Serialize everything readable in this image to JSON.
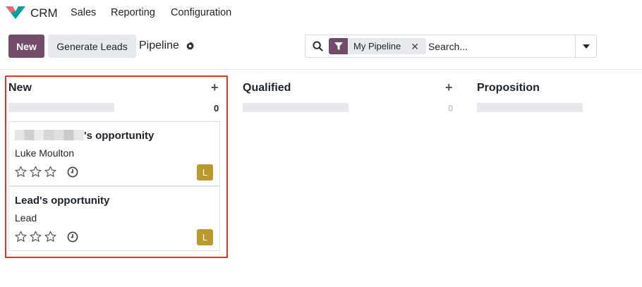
{
  "topnav": {
    "app_name": "CRM",
    "items": [
      "Sales",
      "Reporting",
      "Configuration"
    ]
  },
  "toolbar": {
    "new_label": "New",
    "generate_label": "Generate Leads",
    "breadcrumb": "Pipeline"
  },
  "search": {
    "facet_label": "My Pipeline",
    "placeholder": "Search..."
  },
  "columns": [
    {
      "title": "New",
      "count": "0",
      "add": "+"
    },
    {
      "title": "Qualified",
      "count": "0",
      "add": "+"
    },
    {
      "title": "Proposition",
      "count": "",
      "add": ""
    }
  ],
  "cards": [
    {
      "title_suffix": "'s opportunity",
      "subtitle": "Luke Moulton",
      "avatar": "L"
    },
    {
      "title": "Lead's opportunity",
      "subtitle": "Lead",
      "avatar": "L"
    }
  ],
  "colors": {
    "primary": "#714b67",
    "highlight": "#e5341f",
    "avatar": "#b89a2e"
  }
}
